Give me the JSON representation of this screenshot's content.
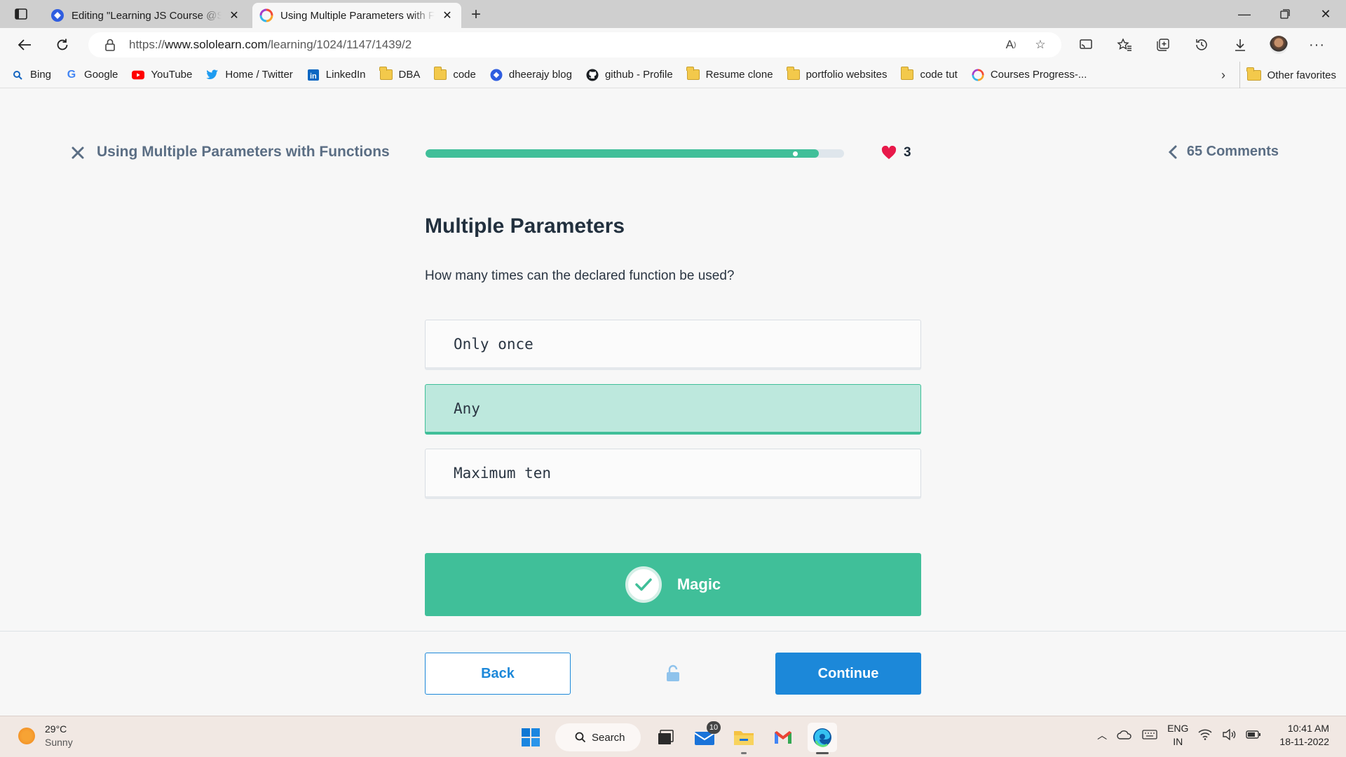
{
  "browser": {
    "tabs": [
      {
        "title": "Editing \"Learning JS Course @Sololearn\"",
        "active": false
      },
      {
        "title": "Using Multiple Parameters with Functions",
        "active": true
      }
    ],
    "url_prefix": "https://",
    "url_host": "www.sololearn.com",
    "url_path": "/learning/1024/1147/1439/2",
    "bookmarks": [
      {
        "label": "Bing",
        "icon": "bing-icon"
      },
      {
        "label": "Google",
        "icon": "google-icon"
      },
      {
        "label": "YouTube",
        "icon": "youtube-icon"
      },
      {
        "label": "Home / Twitter",
        "icon": "twitter-icon"
      },
      {
        "label": "LinkedIn",
        "icon": "linkedin-icon"
      },
      {
        "label": "DBA",
        "icon": "folder-icon"
      },
      {
        "label": "code",
        "icon": "folder-icon"
      },
      {
        "label": "dheerajy blog",
        "icon": "blog-icon"
      },
      {
        "label": "github - Profile",
        "icon": "github-icon"
      },
      {
        "label": "Resume clone",
        "icon": "folder-icon"
      },
      {
        "label": "portfolio websites",
        "icon": "folder-icon"
      },
      {
        "label": "code tut",
        "icon": "folder-icon"
      },
      {
        "label": "Courses Progress-...",
        "icon": "sololearn-icon"
      }
    ],
    "other_favorites": "Other favorites"
  },
  "lesson": {
    "title": "Using Multiple Parameters with Functions",
    "progress": 0.94,
    "hearts": "3",
    "comments": "65 Comments"
  },
  "question": {
    "heading": "Multiple Parameters",
    "text": "How many times can the declared function be used?",
    "options": [
      {
        "label": "Only once",
        "selected": false
      },
      {
        "label": "Any",
        "selected": true
      },
      {
        "label": "Maximum ten",
        "selected": false
      }
    ],
    "magic_label": "Magic"
  },
  "footer": {
    "back_label": "Back",
    "continue_label": "Continue"
  },
  "taskbar": {
    "temperature": "29°C",
    "weather": "Sunny",
    "search_label": "Search",
    "mail_badge": "10",
    "lang_top": "ENG",
    "lang_bottom": "IN",
    "time": "10:41 AM",
    "date": "18-11-2022"
  },
  "colors": {
    "accent_green": "#40bf99",
    "selected_bg": "#bde8dd",
    "primary_blue": "#1c88d9",
    "heart_red": "#e8194a"
  }
}
